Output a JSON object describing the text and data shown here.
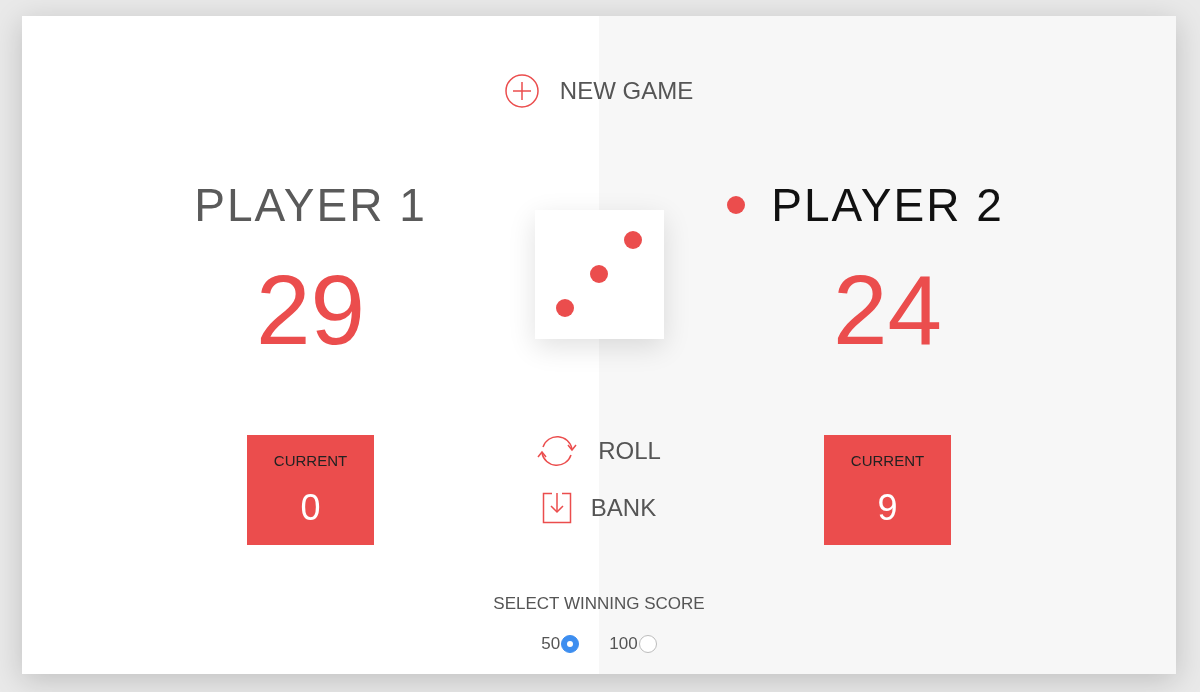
{
  "new_game": {
    "label": "NEW GAME"
  },
  "players": [
    {
      "name": "PLAYER 1",
      "active": false,
      "score": "29",
      "current": {
        "label": "CURRENT",
        "value": "0"
      }
    },
    {
      "name": "PLAYER 2",
      "active": true,
      "score": "24",
      "current": {
        "label": "CURRENT",
        "value": "9"
      }
    }
  ],
  "dice": {
    "pips": [
      {
        "kind": "top-right"
      },
      {
        "kind": "center"
      },
      {
        "kind": "bottom-left"
      }
    ]
  },
  "actions": [
    {
      "kind": "roll",
      "label": "ROLL"
    },
    {
      "kind": "bank",
      "label": "BANK"
    }
  ],
  "winning_score": {
    "label": "SELECT WINNING SCORE",
    "options": [
      {
        "label": "50",
        "selected": true
      },
      {
        "label": "100",
        "selected": false
      }
    ]
  }
}
